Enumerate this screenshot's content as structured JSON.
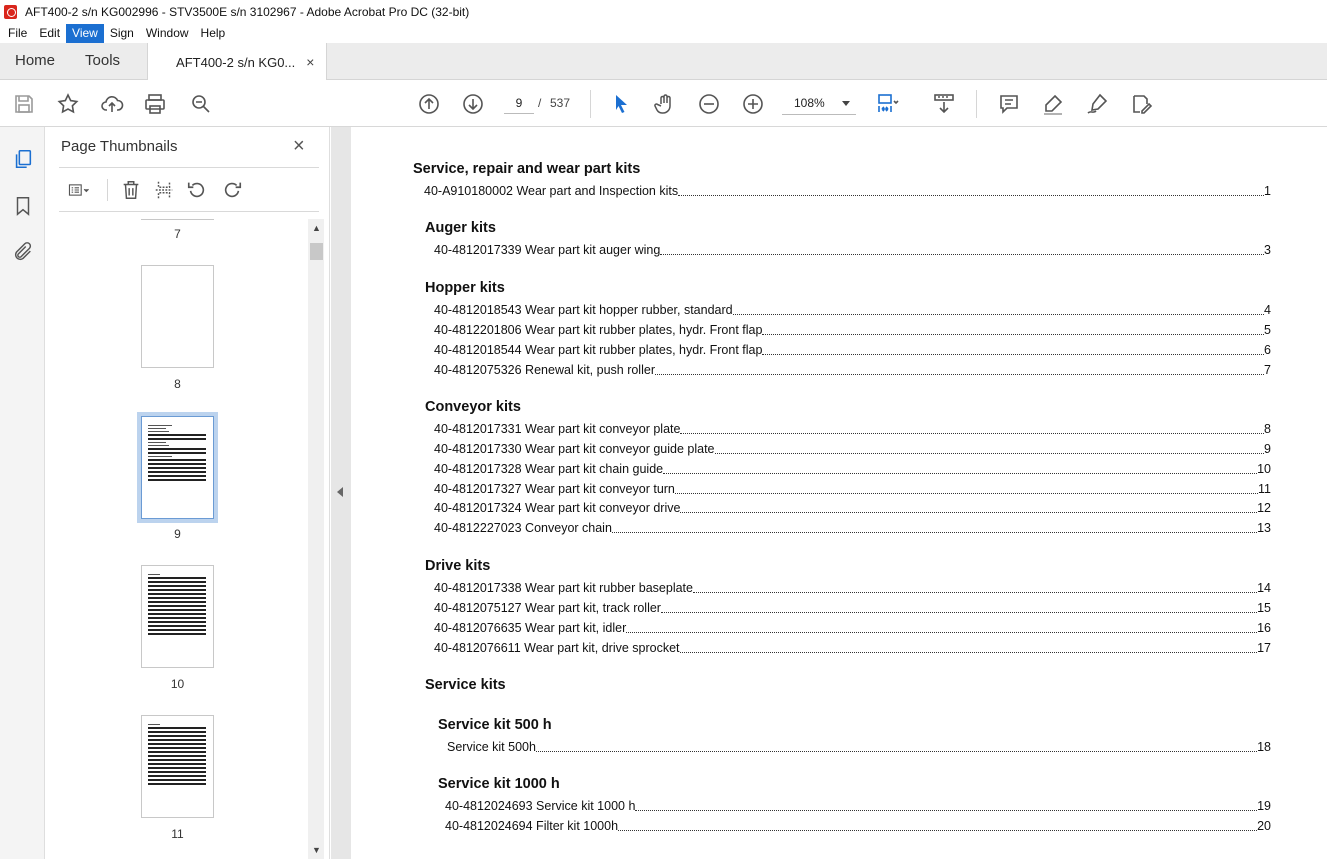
{
  "window": {
    "title": "AFT400-2 s/n KG002996 - STV3500E s/n 3102967 - Adobe Acrobat Pro DC (32-bit)"
  },
  "menu": [
    "File",
    "Edit",
    "View",
    "Sign",
    "Window",
    "Help"
  ],
  "tabs": {
    "home": "Home",
    "tools": "Tools",
    "document": "AFT400-2 s/n KG0...",
    "close": "×"
  },
  "toolbar": {
    "current_page": "9",
    "page_separator": "/",
    "page_count": "537",
    "zoom": "108%"
  },
  "thumbnails_panel": {
    "title": "Page Thumbnails",
    "close": "×",
    "pages": [
      "7",
      "8",
      "9",
      "10",
      "11"
    ],
    "selected_page": "9"
  },
  "document": {
    "sections": [
      {
        "heading": "Service, repair and wear part kits",
        "entries": [
          {
            "text": "40-A910180002 Wear part and Inspection kits",
            "page": "1"
          }
        ]
      },
      {
        "heading": "Auger kits",
        "entries": [
          {
            "text": "40-4812017339 Wear part kit auger wing",
            "page": "3"
          }
        ]
      },
      {
        "heading": "Hopper kits",
        "entries": [
          {
            "text": "40-4812018543 Wear part kit hopper rubber, standard",
            "page": "4"
          },
          {
            "text": "40-4812201806 Wear part kit rubber plates, hydr. Front flap",
            "page": "5"
          },
          {
            "text": "40-4812018544 Wear part kit rubber plates, hydr. Front flap",
            "page": "6"
          },
          {
            "text": "40-4812075326 Renewal kit, push roller",
            "page": "7"
          }
        ]
      },
      {
        "heading": "Conveyor kits",
        "entries": [
          {
            "text": "40-4812017331 Wear part kit conveyor plate",
            "page": "8"
          },
          {
            "text": "40-4812017330 Wear part kit conveyor guide plate",
            "page": "9"
          },
          {
            "text": "40-4812017328 Wear part kit chain guide",
            "page": "10"
          },
          {
            "text": "40-4812017327 Wear part kit conveyor turn",
            "page": "11"
          },
          {
            "text": "40-4812017324 Wear part kit conveyor drive",
            "page": "12"
          },
          {
            "text": "40-4812227023 Conveyor chain",
            "page": "13"
          }
        ]
      },
      {
        "heading": "Drive kits",
        "entries": [
          {
            "text": "40-4812017338 Wear part kit rubber baseplate",
            "page": "14"
          },
          {
            "text": "40-4812075127 Wear part kit, track roller",
            "page": "15"
          },
          {
            "text": "40-4812076635 Wear part kit, idler",
            "page": "16"
          },
          {
            "text": "40-4812076611 Wear part kit, drive sprocket",
            "page": "17"
          }
        ]
      },
      {
        "heading": "Service kits",
        "entries": []
      },
      {
        "heading": "Service kit 500 h",
        "entries": [
          {
            "text": "Service kit 500h",
            "page": "18"
          }
        ]
      },
      {
        "heading": "Service kit 1000 h",
        "entries": [
          {
            "text": "40-4812024693 Service kit 1000 h",
            "page": "19"
          },
          {
            "text": "40-4812024694 Filter kit 1000h",
            "page": "20"
          }
        ]
      }
    ]
  }
}
